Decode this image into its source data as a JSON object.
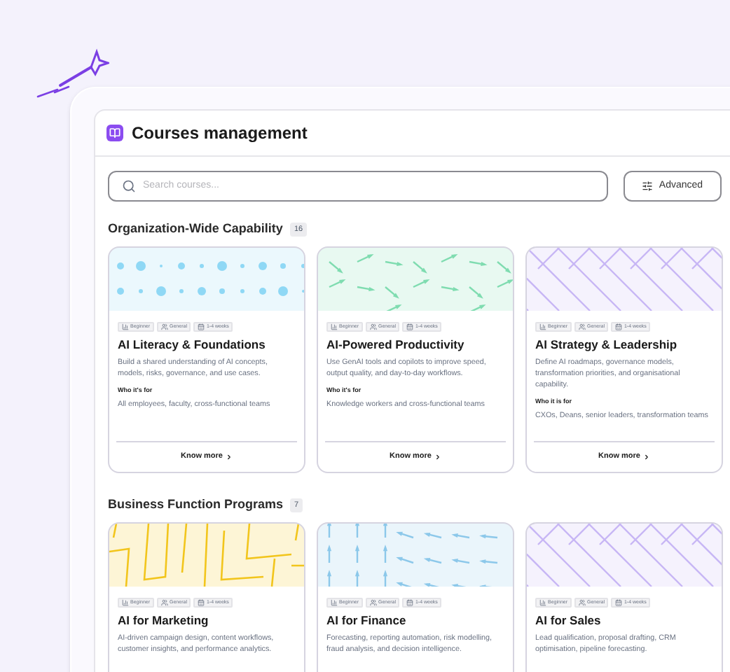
{
  "header": {
    "title": "Courses management"
  },
  "search": {
    "placeholder": "Search courses..."
  },
  "advanced_button": {
    "label": "Advanced"
  },
  "sections": [
    {
      "title": "Organization-Wide Capability",
      "count": "16",
      "courses": [
        {
          "kind": "dots",
          "color": "#8fd8f5",
          "tags": [
            {
              "kind": "level",
              "label": "Beginner"
            },
            {
              "kind": "audience",
              "label": "General"
            },
            {
              "kind": "duration",
              "label": "1-4 weeks"
            }
          ],
          "title": "AI Literacy & Foundations",
          "description": "Build a shared understanding of AI concepts, models, risks, governance, and use cases.",
          "audience_heading": "Who it's for",
          "audience": "All employees, faculty, cross-functional teams",
          "link": "Know more"
        },
        {
          "kind": "arrows",
          "color": "#7fdcb0",
          "tags": [
            {
              "kind": "level",
              "label": "Beginner"
            },
            {
              "kind": "audience",
              "label": "General"
            },
            {
              "kind": "duration",
              "label": "1-4 weeks"
            }
          ],
          "title": "AI-Powered Productivity",
          "description": "Use GenAI tools and copilots to improve speed, output quality, and day-to-day workflows.",
          "audience_heading": "Who it's for",
          "audience": "Knowledge workers and cross-functional teams",
          "link": "Know more"
        },
        {
          "kind": "lattice",
          "color": "#c7b6f5",
          "tags": [
            {
              "kind": "level",
              "label": "Beginner"
            },
            {
              "kind": "audience",
              "label": "General"
            },
            {
              "kind": "duration",
              "label": "1-4 weeks"
            }
          ],
          "title": "AI Strategy & Leadership",
          "description": "Define AI roadmaps, governance models, transformation priorities, and organisational capability.",
          "audience_heading": "Who it is for",
          "audience": "CXOs, Deans, senior leaders, transformation teams",
          "link": "Know more"
        }
      ]
    },
    {
      "title": "Business Function Programs",
      "count": "7",
      "courses": [
        {
          "kind": "maze",
          "color": "#f2c51c",
          "tags": [
            {
              "kind": "level",
              "label": "Beginner"
            },
            {
              "kind": "audience",
              "label": "General"
            },
            {
              "kind": "duration",
              "label": "1-4 weeks"
            }
          ],
          "title": "AI for Marketing",
          "description": "AI-driven campaign design, content workflows, customer insights, and performance analytics."
        },
        {
          "kind": "arrows-up",
          "color": "#8cc8ea",
          "tags": [
            {
              "kind": "level",
              "label": "Beginner"
            },
            {
              "kind": "audience",
              "label": "General"
            },
            {
              "kind": "duration",
              "label": "1-4 weeks"
            }
          ],
          "title": "AI for Finance",
          "description": "Forecasting, reporting automation, risk modelling, fraud analysis, and decision intelligence."
        },
        {
          "kind": "lattice",
          "color": "#c7b6f5",
          "tags": [
            {
              "kind": "level",
              "label": "Beginner"
            },
            {
              "kind": "audience",
              "label": "General"
            },
            {
              "kind": "duration",
              "label": "1-4 weeks"
            }
          ],
          "title": "AI for Sales",
          "description": "Lead qualification, proposal drafting, CRM optimisation, pipeline forecasting."
        }
      ]
    }
  ]
}
